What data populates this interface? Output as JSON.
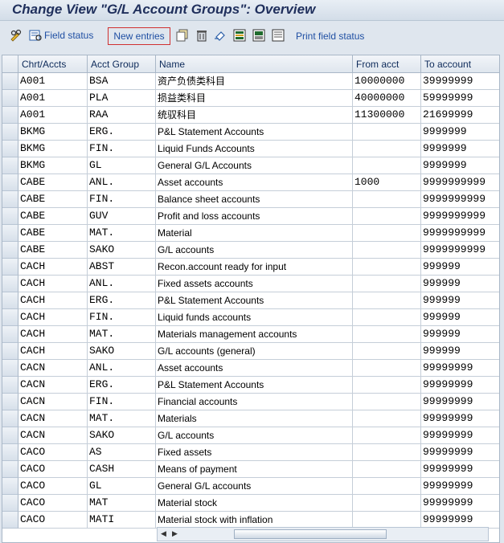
{
  "window": {
    "title": "Change View \"G/L Account Groups\": Overview"
  },
  "toolbar": {
    "field_status_label": "Field status",
    "new_entries_label": "New entries",
    "print_field_status_label": "Print field status"
  },
  "table": {
    "columns": [
      "Chrt/Accts",
      "Acct Group",
      "Name",
      "From acct",
      "To account"
    ],
    "rows": [
      [
        "A001",
        "BSA",
        "资产负债类科目",
        "10000000",
        "39999999"
      ],
      [
        "A001",
        "PLA",
        "损益类科目",
        "40000000",
        "59999999"
      ],
      [
        "A001",
        "RAA",
        "统驭科目",
        "11300000",
        "21699999"
      ],
      [
        "BKMG",
        "ERG.",
        "P&L Statement Accounts",
        "",
        "9999999"
      ],
      [
        "BKMG",
        "FIN.",
        "Liquid Funds Accounts",
        "",
        "9999999"
      ],
      [
        "BKMG",
        "GL",
        "General G/L Accounts",
        "",
        "9999999"
      ],
      [
        "CABE",
        "ANL.",
        "Asset accounts",
        "1000",
        "9999999999"
      ],
      [
        "CABE",
        "FIN.",
        "Balance sheet accounts",
        "",
        "9999999999"
      ],
      [
        "CABE",
        "GUV",
        "Profit and loss accounts",
        "",
        "9999999999"
      ],
      [
        "CABE",
        "MAT.",
        "Material",
        "",
        "9999999999"
      ],
      [
        "CABE",
        "SAKO",
        "G/L accounts",
        "",
        "9999999999"
      ],
      [
        "CACH",
        "ABST",
        "Recon.account ready for input",
        "",
        "999999"
      ],
      [
        "CACH",
        "ANL.",
        "Fixed assets accounts",
        "",
        "999999"
      ],
      [
        "CACH",
        "ERG.",
        "P&L Statement Accounts",
        "",
        "999999"
      ],
      [
        "CACH",
        "FIN.",
        "Liquid funds accounts",
        "",
        "999999"
      ],
      [
        "CACH",
        "MAT.",
        "Materials management accounts",
        "",
        "999999"
      ],
      [
        "CACH",
        "SAKO",
        "G/L accounts (general)",
        "",
        "999999"
      ],
      [
        "CACN",
        "ANL.",
        "Asset accounts",
        "",
        "99999999"
      ],
      [
        "CACN",
        "ERG.",
        "P&L Statement Accounts",
        "",
        "99999999"
      ],
      [
        "CACN",
        "FIN.",
        "Financial accounts",
        "",
        "99999999"
      ],
      [
        "CACN",
        "MAT.",
        "Materials",
        "",
        "99999999"
      ],
      [
        "CACN",
        "SAKO",
        "G/L accounts",
        "",
        "99999999"
      ],
      [
        "CACO",
        "AS",
        "Fixed assets",
        "",
        "99999999"
      ],
      [
        "CACO",
        "CASH",
        "Means of payment",
        "",
        "99999999"
      ],
      [
        "CACO",
        "GL",
        "General G/L accounts",
        "",
        "99999999"
      ],
      [
        "CACO",
        "MAT",
        "Material stock",
        "",
        "99999999"
      ],
      [
        "CACO",
        "MATI",
        "Material stock with inflation",
        "",
        "99999999"
      ]
    ]
  },
  "icons": [
    "glasses-edit-icon",
    "field-status-icon",
    "copy-icon",
    "delete-icon",
    "undo-icon",
    "select-all-icon",
    "select-block-icon",
    "deselect-icon"
  ],
  "colors": {
    "title": "#1f2f5c",
    "link": "#1f4fa3",
    "highlight_border": "#d03030",
    "background": "#dfe6ee"
  }
}
